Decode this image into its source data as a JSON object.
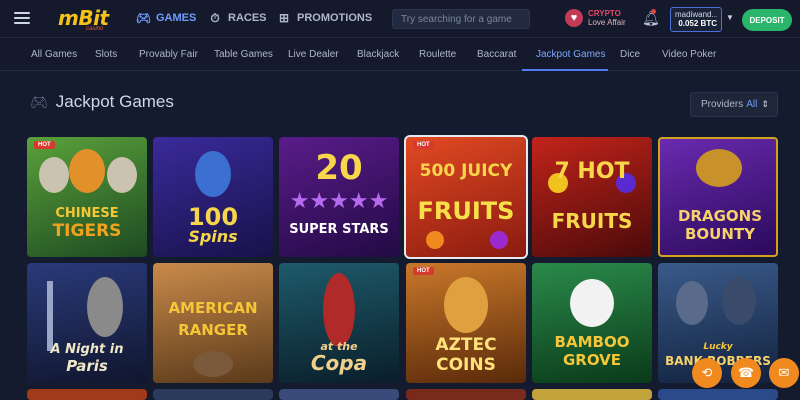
{
  "header": {
    "logo_text": "mBit",
    "logo_sub": "casino",
    "nav": [
      {
        "label": "GAMES",
        "icon": "gamepad-icon"
      },
      {
        "label": "RACES",
        "icon": "stopwatch-icon"
      },
      {
        "label": "PROMOTIONS",
        "icon": "gift-icon"
      }
    ],
    "search_placeholder": "Try searching for a game",
    "crypto_line1": "CRYPTO",
    "crypto_line2": "Love Affair",
    "account_name": "madiwand...",
    "balance": "0.052 BTC",
    "deposit_label": "DEPOSIT"
  },
  "tabs": [
    "All Games",
    "Slots",
    "Provably Fair",
    "Table Games",
    "Live Dealer",
    "Blackjack",
    "Roulette",
    "Baccarat",
    "Jackpot Games",
    "Dice",
    "Video Poker"
  ],
  "active_tab": "Jackpot Games",
  "section": {
    "title": "Jackpot Games",
    "providers_label": "Providers",
    "providers_value": "All"
  },
  "games": [
    {
      "line1": "CHINESE",
      "line2": "TIGERS",
      "hot": "HOT",
      "color": "#2f6a2a"
    },
    {
      "line1": "100",
      "line2": "Spins",
      "hot": "",
      "color": "#3a2a8a"
    },
    {
      "line1": "20",
      "line2": "SUPER STARS",
      "hot": "",
      "color": "#4a1a7a"
    },
    {
      "line1": "500 JUICY",
      "line2": "FRUITS",
      "hot": "HOT",
      "color": "#c2311e"
    },
    {
      "line1": "7 HOT",
      "line2": "FRUITS",
      "hot": "",
      "color": "#8a1a1a"
    },
    {
      "line1": "DRAGONS",
      "line2": "BOUNTY",
      "hot": "",
      "color": "#5a2a9a"
    },
    {
      "line1": "A Night in",
      "line2": "Paris",
      "hot": "",
      "color": "#24356a"
    },
    {
      "line1": "AMERICAN",
      "line2": "RANGER",
      "hot": "",
      "color": "#8a5a2a"
    },
    {
      "line1": "at the",
      "line2": "Copa",
      "hot": "",
      "color": "#1e5a6a"
    },
    {
      "line1": "AZTEC",
      "line2": "COINS",
      "hot": "HOT",
      "color": "#8a4a12"
    },
    {
      "line1": "BAMBOO",
      "line2": "GROVE",
      "hot": "",
      "color": "#1a6a3a"
    },
    {
      "line1": "Lucky",
      "line2": "BANK ROBBERS",
      "hot": "",
      "color": "#2a4a7a"
    }
  ],
  "fab_icons": [
    "history-icon",
    "support-icon",
    "chat-icon"
  ]
}
